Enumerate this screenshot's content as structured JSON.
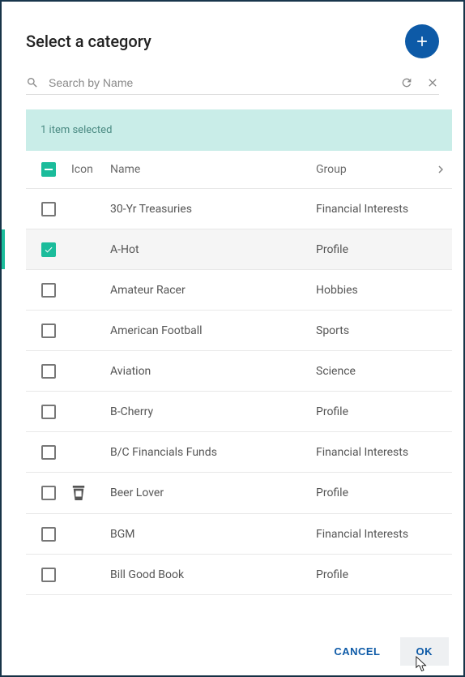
{
  "dialog": {
    "title": "Select a category",
    "search_placeholder": "Search by Name",
    "selection_banner": "1 item selected",
    "columns": {
      "icon": "Icon",
      "name": "Name",
      "group": "Group"
    },
    "rows": [
      {
        "name": "30-Yr Treasuries",
        "group": "Financial Interests",
        "selected": false,
        "icon": null
      },
      {
        "name": "A-Hot",
        "group": "Profile",
        "selected": true,
        "icon": null
      },
      {
        "name": "Amateur Racer",
        "group": "Hobbies",
        "selected": false,
        "icon": null
      },
      {
        "name": "American Football",
        "group": "Sports",
        "selected": false,
        "icon": null
      },
      {
        "name": "Aviation",
        "group": "Science",
        "selected": false,
        "icon": null
      },
      {
        "name": "B-Cherry",
        "group": "Profile",
        "selected": false,
        "icon": null
      },
      {
        "name": "B/C Financials Funds",
        "group": "Financial Interests",
        "selected": false,
        "icon": null
      },
      {
        "name": "Beer Lover",
        "group": "Profile",
        "selected": false,
        "icon": "cup"
      },
      {
        "name": "BGM",
        "group": "Financial Interests",
        "selected": false,
        "icon": null
      },
      {
        "name": "Bill Good Book",
        "group": "Profile",
        "selected": false,
        "icon": null
      }
    ],
    "buttons": {
      "cancel": "CANCEL",
      "ok": "OK"
    }
  }
}
